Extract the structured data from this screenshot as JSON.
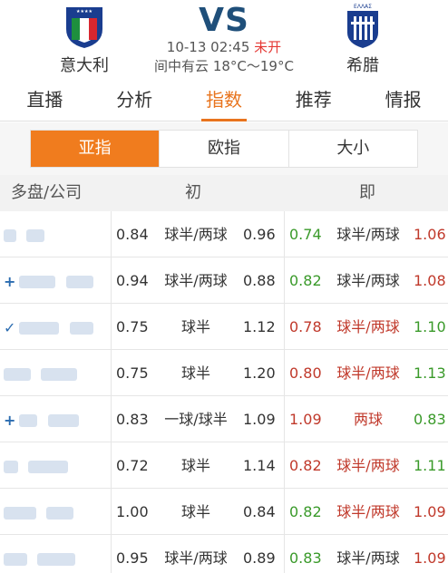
{
  "match": {
    "home_team": "意大利",
    "away_team": "希腊",
    "vs_label": "VS",
    "datetime": "10-13 02:45",
    "status": "未开",
    "weather": "间中有云 18°C～19°C",
    "away_crest_text": "ΕΛΛΑΣ",
    "colors": {
      "vs": "#1f4f7a",
      "status": "#e53935"
    }
  },
  "tabs": [
    {
      "label": "直播"
    },
    {
      "label": "分析"
    },
    {
      "label": "指数",
      "active": true
    },
    {
      "label": "推荐"
    },
    {
      "label": "情报"
    }
  ],
  "subtabs": [
    {
      "label": "亚指",
      "active": true
    },
    {
      "label": "欧指"
    },
    {
      "label": "大小"
    }
  ],
  "table": {
    "headers": {
      "company": "多盘/公司",
      "initial": "初",
      "current": "即"
    },
    "rows": [
      {
        "init_home": "0.84",
        "init_handicap": "球半/两球",
        "init_away": "0.96",
        "now_home": "0.74",
        "now_home_color": "green",
        "now_handicap": "球半/两球",
        "now_handicap_color": "neutral",
        "now_away": "1.06",
        "now_away_color": "red"
      },
      {
        "mark": "+",
        "init_home": "0.94",
        "init_handicap": "球半/两球",
        "init_away": "0.88",
        "now_home": "0.82",
        "now_home_color": "green",
        "now_handicap": "球半/两球",
        "now_handicap_color": "neutral",
        "now_away": "1.08",
        "now_away_color": "red"
      },
      {
        "mark": "✓",
        "init_home": "0.75",
        "init_handicap": "球半",
        "init_away": "1.12",
        "now_home": "0.78",
        "now_home_color": "red",
        "now_handicap": "球半/两球",
        "now_handicap_color": "red",
        "now_away": "1.10",
        "now_away_color": "green"
      },
      {
        "init_home": "0.75",
        "init_handicap": "球半",
        "init_away": "1.20",
        "now_home": "0.80",
        "now_home_color": "red",
        "now_handicap": "球半/两球",
        "now_handicap_color": "red",
        "now_away": "1.13",
        "now_away_color": "green"
      },
      {
        "mark": "+",
        "init_home": "0.83",
        "init_handicap": "一球/球半",
        "init_away": "1.09",
        "now_home": "1.09",
        "now_home_color": "red",
        "now_handicap": "两球",
        "now_handicap_color": "red",
        "now_away": "0.83",
        "now_away_color": "green"
      },
      {
        "init_home": "0.72",
        "init_handicap": "球半",
        "init_away": "1.14",
        "now_home": "0.82",
        "now_home_color": "red",
        "now_handicap": "球半/两球",
        "now_handicap_color": "red",
        "now_away": "1.11",
        "now_away_color": "green"
      },
      {
        "init_home": "1.00",
        "init_handicap": "球半",
        "init_away": "0.84",
        "now_home": "0.82",
        "now_home_color": "green",
        "now_handicap": "球半/两球",
        "now_handicap_color": "red",
        "now_away": "1.09",
        "now_away_color": "red"
      },
      {
        "init_home": "0.95",
        "init_handicap": "球半/两球",
        "init_away": "0.89",
        "now_home": "0.83",
        "now_home_color": "green",
        "now_handicap": "球半/两球",
        "now_handicap_color": "neutral",
        "now_away": "1.09",
        "now_away_color": "red"
      }
    ]
  }
}
